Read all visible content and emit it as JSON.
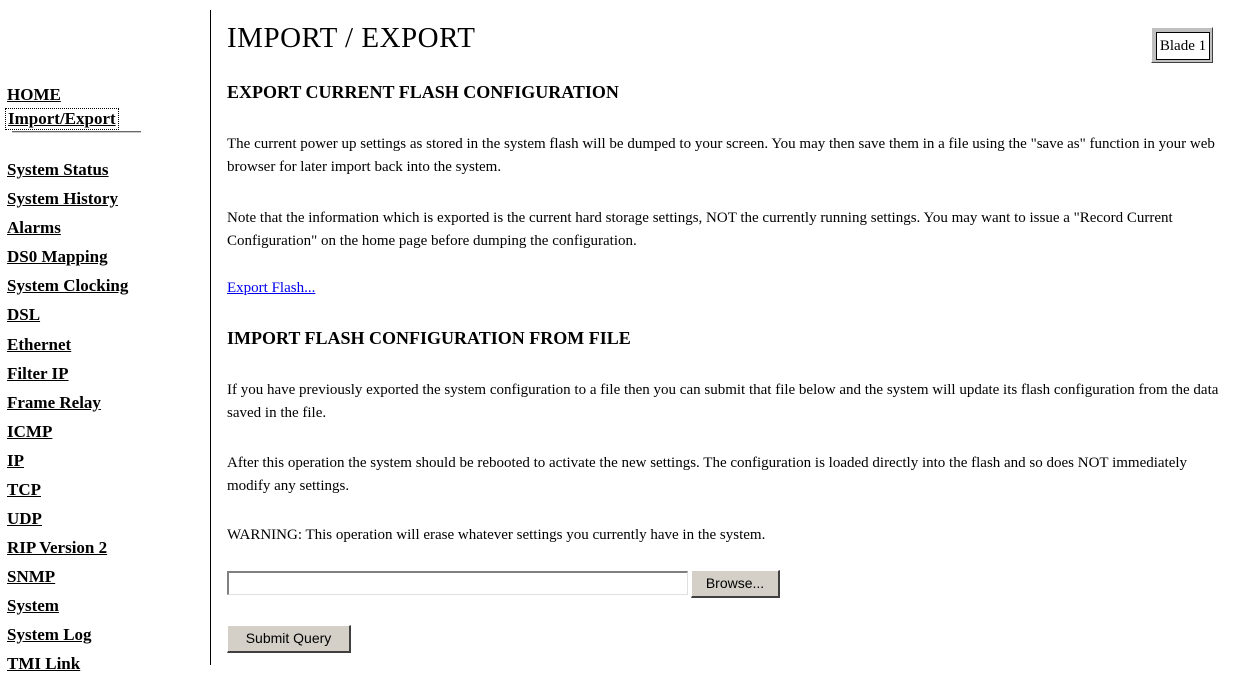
{
  "sidebar": {
    "items": [
      {
        "label": "HOME",
        "active": false
      },
      {
        "label": "Import/Export",
        "active": true
      },
      {
        "label": "System Status",
        "active": false
      },
      {
        "label": "System History",
        "active": false
      },
      {
        "label": "Alarms",
        "active": false
      },
      {
        "label": "DS0 Mapping",
        "active": false
      },
      {
        "label": "System Clocking",
        "active": false
      },
      {
        "label": "DSL",
        "active": false
      },
      {
        "label": "Ethernet",
        "active": false
      },
      {
        "label": "Filter IP",
        "active": false
      },
      {
        "label": "Frame Relay",
        "active": false
      },
      {
        "label": "ICMP",
        "active": false
      },
      {
        "label": "IP",
        "active": false
      },
      {
        "label": "TCP",
        "active": false
      },
      {
        "label": "UDP",
        "active": false
      },
      {
        "label": "RIP Version 2",
        "active": false
      },
      {
        "label": "SNMP",
        "active": false
      },
      {
        "label": "System",
        "active": false
      },
      {
        "label": "System Log",
        "active": false
      },
      {
        "label": "TMI Link",
        "active": false
      }
    ]
  },
  "main": {
    "title": "IMPORT / EXPORT",
    "blade_label": "Blade 1",
    "export_section": {
      "heading": "EXPORT CURRENT FLASH CONFIGURATION",
      "paragraph_1": "The current power up settings as stored in the system flash will be dumped to your screen. You may then save them in a file using the \"save as\" function in your web browser for later import back into the system.",
      "paragraph_2": "Note that the information which is exported is the current hard storage settings, NOT the currently running settings. You may want to issue a \"Record Current Configuration\" on the home page before dumping the configuration.",
      "link_label": "Export Flash..."
    },
    "import_section": {
      "heading": "IMPORT FLASH CONFIGURATION FROM FILE",
      "paragraph_1": "If you have previously exported the system configuration to a file then you can submit that file below and the system will update its flash configuration from the data saved in the file.",
      "paragraph_2": "After this operation the system should be rebooted to activate the new settings. The configuration is loaded directly into the flash and so does NOT immediately modify any settings.",
      "warning": "WARNING: This operation will erase whatever settings you currently have in the system.",
      "file_input_value": "",
      "browse_label": "Browse...",
      "submit_label": "Submit Query"
    }
  },
  "colors": {
    "link": "#0000ee",
    "button_face": "#d4d0c8",
    "blade_frame": "#c0c0c0"
  }
}
